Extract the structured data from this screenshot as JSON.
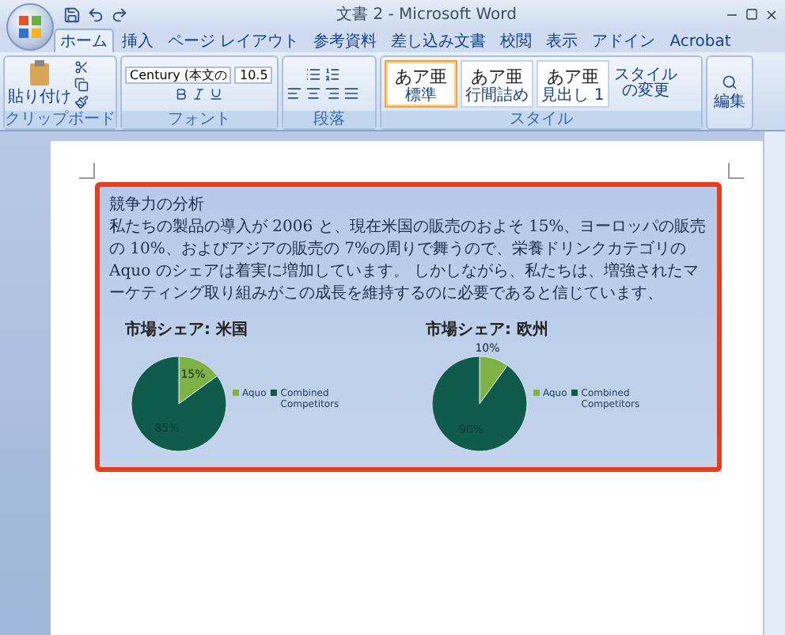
{
  "window": {
    "title": "文書 2 - Microsoft Word"
  },
  "tabs": [
    {
      "label": "ホーム",
      "selected": true
    },
    {
      "label": "挿入",
      "selected": false
    },
    {
      "label": "ページ レイアウト",
      "selected": false
    },
    {
      "label": "参考資料",
      "selected": false
    },
    {
      "label": "差し込み文書",
      "selected": false
    },
    {
      "label": "校閲",
      "selected": false
    },
    {
      "label": "表示",
      "selected": false
    },
    {
      "label": "アドイン",
      "selected": false
    },
    {
      "label": "Acrobat",
      "selected": false
    }
  ],
  "ribbon": {
    "clipboard": {
      "label": "クリップボード",
      "paste": "貼り付け"
    },
    "font": {
      "label": "フォント",
      "font_name": "Century (本文の",
      "font_size": "10.5"
    },
    "paragraph": {
      "label": "段落"
    },
    "styles": {
      "label": "スタイル",
      "change_styles": "スタイルの変更",
      "items": [
        {
          "preview": "あア亜",
          "name": "標準",
          "selected": true
        },
        {
          "preview": "あア亜",
          "name": "行間詰め",
          "selected": false
        },
        {
          "preview": "あア亜",
          "name": "見出し 1",
          "selected": false
        }
      ]
    },
    "editing": {
      "label": "編集"
    }
  },
  "document": {
    "heading": "競争力の分析",
    "paragraph": "私たちの製品の導入が 2006 と、現在米国の販売のおよそ 15%、ヨーロッパの販売の 10%、およびアジアの販売の 7%の周りで舞うので、栄養ドリンクカテゴリの Aquo のシェアは着実に増加しています。 しかしながら、私たちは、増強されたマーケティング取り組みがこの成長を維持するのに必要であると信じています、",
    "charts": [
      {
        "chart_data": {
          "type": "pie",
          "title": "市場シェア: 米国",
          "categories": [
            "Aquo",
            "Combined Competitors"
          ],
          "values": [
            15,
            85
          ],
          "value_labels": [
            "15%",
            "85%"
          ],
          "legend": "right"
        }
      },
      {
        "chart_data": {
          "type": "pie",
          "title": "市場シェア: 欧州",
          "categories": [
            "Aquo",
            "Combined Competitors"
          ],
          "values": [
            10,
            90
          ],
          "value_labels": [
            "10%",
            "90%"
          ],
          "legend": "right"
        }
      }
    ]
  }
}
